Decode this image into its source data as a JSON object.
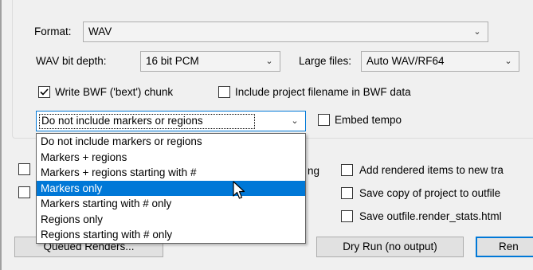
{
  "format": {
    "label": "Format:",
    "value": "WAV"
  },
  "wav_bit_depth": {
    "label": "WAV bit depth:",
    "value": "16 bit PCM"
  },
  "large_files": {
    "label": "Large files:",
    "value": "Auto WAV/RF64"
  },
  "write_bwf": {
    "label": "Write BWF ('bext') chunk",
    "checked": true
  },
  "include_project_filename": {
    "label": "Include project filename in BWF data",
    "checked": false
  },
  "markers_combo": {
    "value": "Do not include markers or regions",
    "options": [
      "Do not include markers or regions",
      "Markers + regions",
      "Markers + regions starting with #",
      "Markers only",
      "Markers starting with # only",
      "Regions only",
      "Regions starting with # only"
    ],
    "highlighted_index": 3
  },
  "embed_tempo": {
    "label": "Embed tempo",
    "checked": false
  },
  "partial_behind_text": "ng",
  "right_options": {
    "add_rendered": "Add rendered items to new tra",
    "save_copy": "Save copy of project to outfile",
    "save_stats": "Save outfile.render_stats.html"
  },
  "buttons": {
    "queued_renders": "Queued Renders...",
    "dry_run": "Dry Run (no output)",
    "render": "Ren"
  }
}
